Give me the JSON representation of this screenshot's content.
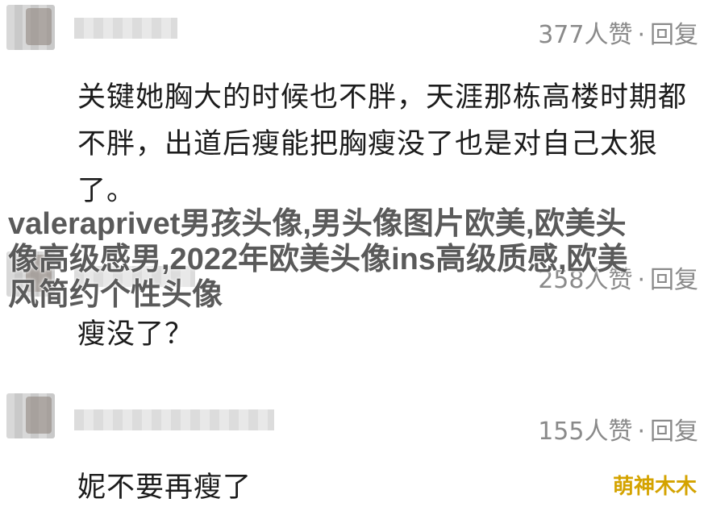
{
  "comments": [
    {
      "likes": "377人赞",
      "separator": "·",
      "reply": "回复",
      "text": "关键她胸大的时候也不胖，天涯那栋高楼时期都不胖，出道后瘦能把胸瘦没了也是对自己太狠了。"
    },
    {
      "likes": "258人赞",
      "separator": "·",
      "reply": "回复",
      "text": "瘦没了？"
    },
    {
      "likes": "155人赞",
      "separator": "·",
      "reply": "回复",
      "text": "妮不要再瘦了"
    }
  ],
  "overlay_caption": "valeraprivet男孩头像,男头像图片欧美,欧美头像高级感男,2022年欧美头像ins高级质感,欧美风简约个性头像",
  "watermark": "萌神木木"
}
